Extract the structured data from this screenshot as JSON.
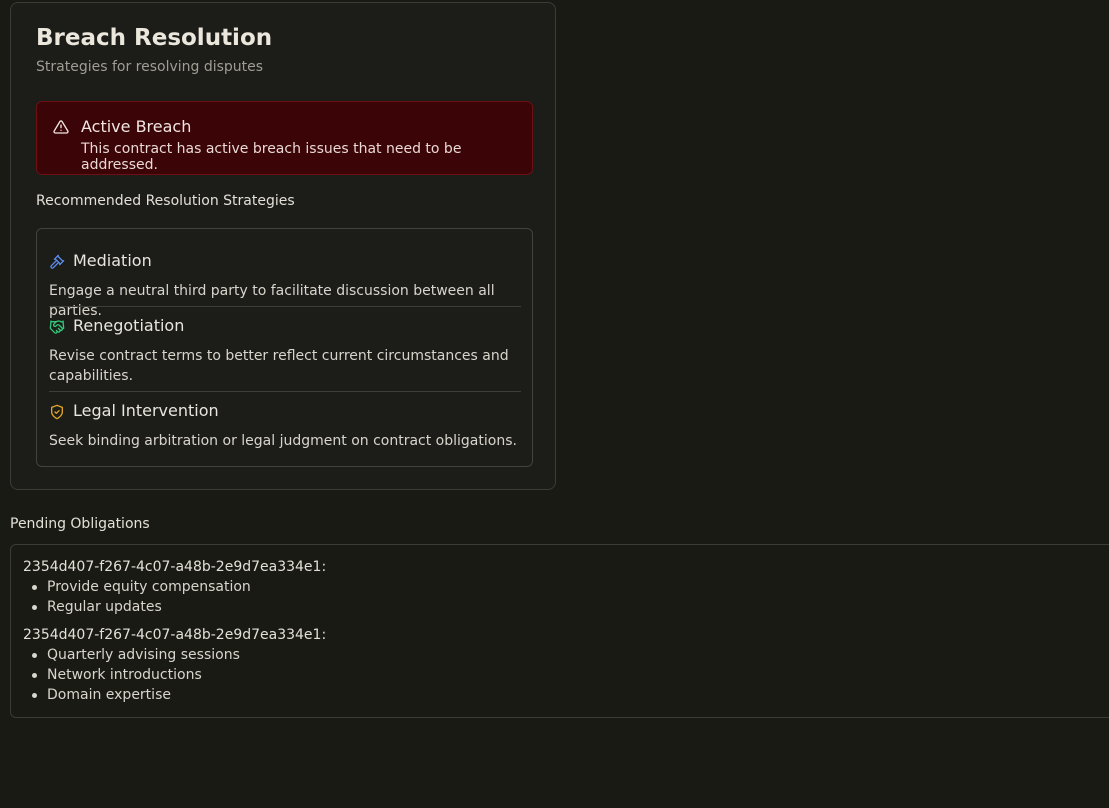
{
  "card": {
    "title": "Breach Resolution",
    "subtitle": "Strategies for resolving disputes"
  },
  "alert": {
    "icon": "alert-triangle-icon",
    "title": "Active Breach",
    "description": "This contract has active breach issues that need to be addressed."
  },
  "strategies_label": "Recommended Resolution Strategies",
  "strategies": [
    {
      "icon": "gavel-icon",
      "icon_color": "#5b8def",
      "title": "Mediation",
      "description": "Engage a neutral third party to facilitate discussion between all parties."
    },
    {
      "icon": "handshake-icon",
      "icon_color": "#34c77b",
      "title": "Renegotiation",
      "description": "Revise contract terms to better reflect current circumstances and capabilities."
    },
    {
      "icon": "shield-check-icon",
      "icon_color": "#e0a526",
      "title": "Legal Intervention",
      "description": "Seek binding arbitration or legal judgment on contract obligations."
    }
  ],
  "pending": {
    "label": "Pending Obligations",
    "groups": [
      {
        "id": "2354d407-f267-4c07-a48b-2e9d7ea334e1:",
        "items": [
          "Provide equity compensation",
          "Regular updates"
        ]
      },
      {
        "id": "2354d407-f267-4c07-a48b-2e9d7ea334e1:",
        "items": [
          "Quarterly advising sessions",
          "Network introductions",
          "Domain expertise"
        ]
      }
    ]
  }
}
